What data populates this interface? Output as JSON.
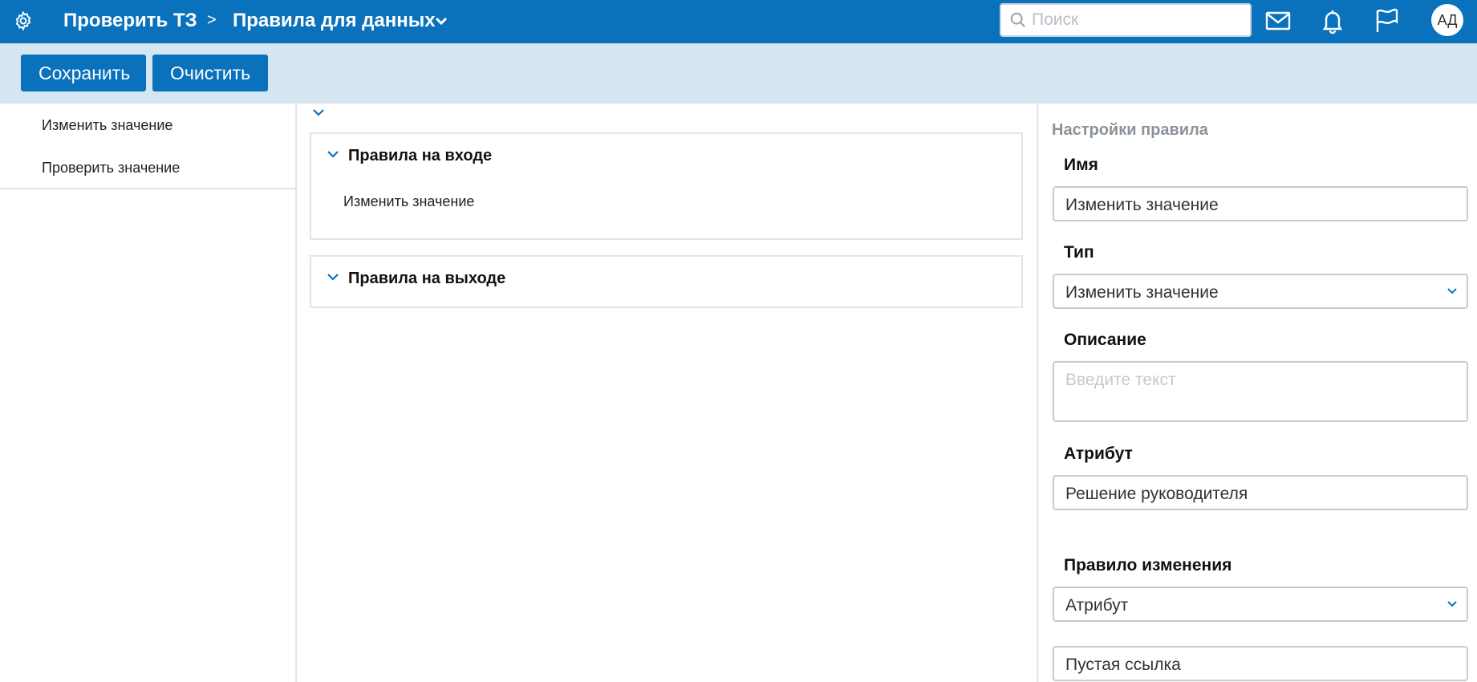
{
  "header": {
    "crumb1": "Проверить ТЗ",
    "separator": ">",
    "crumb2": "Правила для данных",
    "search_placeholder": "Поиск",
    "avatar_initials": "АД",
    "icons": [
      "gear-icon",
      "chevron-right-icon",
      "chevron-down-icon",
      "search-icon",
      "mail-icon",
      "bell-icon",
      "flag-icon"
    ],
    "accent": "#0a72bd"
  },
  "toolbar": {
    "save_label": "Сохранить",
    "clear_label": "Очистить",
    "background": "#d6e6f1"
  },
  "sidebar": {
    "items": [
      {
        "label": "Изменить значение"
      },
      {
        "label": "Проверить значение"
      }
    ]
  },
  "main": {
    "panels": [
      {
        "title": "Правила на входе",
        "items": [
          "Изменить значение"
        ]
      },
      {
        "title": "Правила на выходе",
        "items": []
      }
    ]
  },
  "settings": {
    "title": "Настройки правила",
    "name_label": "Имя",
    "name_value": "Изменить значение",
    "type_label": "Тип",
    "type_value": "Изменить значение",
    "description_label": "Описание",
    "description_placeholder": "Введите текст",
    "attribute_label": "Атрибут",
    "attribute_value": "Решение руководителя",
    "change_rule_label": "Правило изменения",
    "change_rule_value": "Атрибут",
    "link_value": "Пустая ссылка"
  }
}
